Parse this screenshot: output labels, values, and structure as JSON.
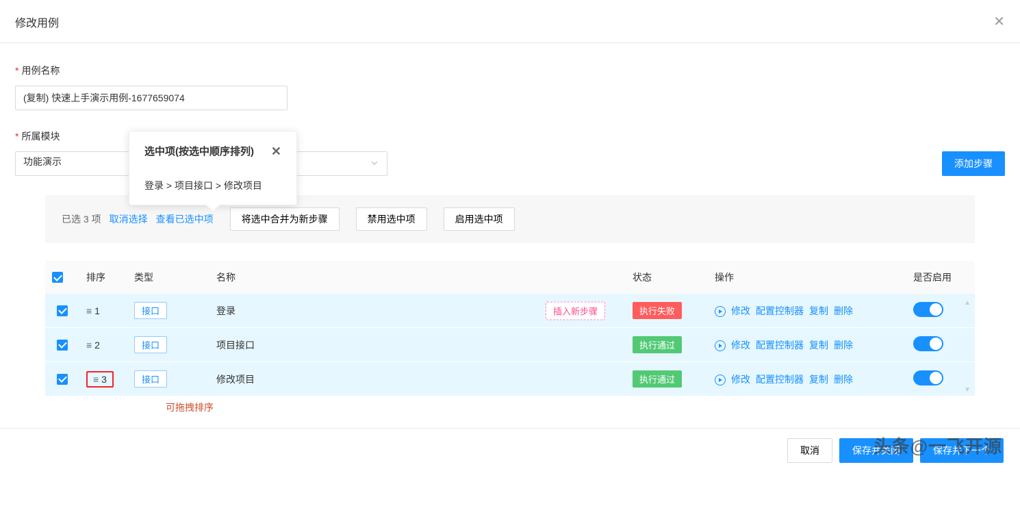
{
  "header": {
    "title": "修改用例"
  },
  "form": {
    "name_label": "用例名称",
    "name_value": "(复制) 快速上手演示用例-1677659074",
    "module_label": "所属模块",
    "module_value": "功能演示",
    "add_step_label": "添加步骤"
  },
  "popover": {
    "title": "选中项(按选中顺序排列)",
    "content": "登录 > 项目接口 > 修改项目"
  },
  "selection": {
    "prefix": "已选",
    "count": "3",
    "suffix": "项",
    "cancel": "取消选择",
    "view": "查看已选中项",
    "merge": "将选中合并为新步骤",
    "disable": "禁用选中项",
    "enable": "启用选中项"
  },
  "table": {
    "headers": {
      "order": "排序",
      "type": "类型",
      "name": "名称",
      "status": "状态",
      "ops": "操作",
      "enabled": "是否启用"
    },
    "type_tag": "接口",
    "ops": {
      "edit": "修改",
      "config": "配置控制器",
      "copy": "复制",
      "delete": "删除"
    },
    "insert_hint": "插入新步骤",
    "rows": [
      {
        "order": "1",
        "name": "登录",
        "status_text": "执行失败",
        "status_class": "status-fail",
        "highlight": false
      },
      {
        "order": "2",
        "name": "项目接口",
        "status_text": "执行通过",
        "status_class": "status-pass",
        "highlight": false
      },
      {
        "order": "3",
        "name": "修改项目",
        "status_text": "执行通过",
        "status_class": "status-pass",
        "highlight": true
      }
    ]
  },
  "drag_hint": "可拖拽排序",
  "footer": {
    "cancel": "取消",
    "save_close": "保存并关闭",
    "save_next": "保存并下一个"
  },
  "watermark": "头条@一飞开源"
}
